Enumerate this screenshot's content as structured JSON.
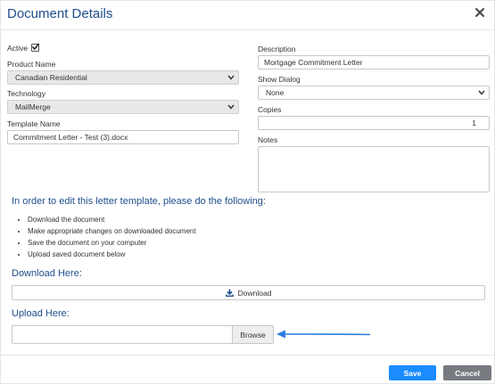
{
  "dialog": {
    "title": "Document Details",
    "close_icon": "close-icon"
  },
  "form": {
    "active_label": "Active",
    "active_checked": true,
    "product_name_label": "Product Name",
    "product_name_value": "Canadian Residential",
    "technology_label": "Technology",
    "technology_value": "MailMerge",
    "template_name_label": "Template Name",
    "template_name_value": "Commitment Letter - Test (3).docx",
    "description_label": "Description",
    "description_value": "Mortgage Commitment Letter",
    "show_dialog_label": "Show Dialog",
    "show_dialog_value": "None",
    "copies_label": "Copies",
    "copies_value": "1",
    "notes_label": "Notes",
    "notes_value": ""
  },
  "instructions": {
    "heading": "In order to edit this letter template, please do the following:",
    "steps": [
      "Download the document",
      "Make appropriate changes on downloaded document",
      "Save the document on your computer",
      "Upload saved document below"
    ]
  },
  "download": {
    "heading": "Download Here:",
    "button_label": "Download",
    "icon": "download-icon"
  },
  "upload": {
    "heading": "Upload Here:",
    "browse_label": "Browse",
    "file_value": ""
  },
  "footer": {
    "save_label": "Save",
    "cancel_label": "Cancel"
  },
  "colors": {
    "heading_blue": "#1f4e8c",
    "save_blue": "#1a8cff",
    "cancel_gray": "#777b80",
    "arrow_blue": "#2a7de1"
  }
}
